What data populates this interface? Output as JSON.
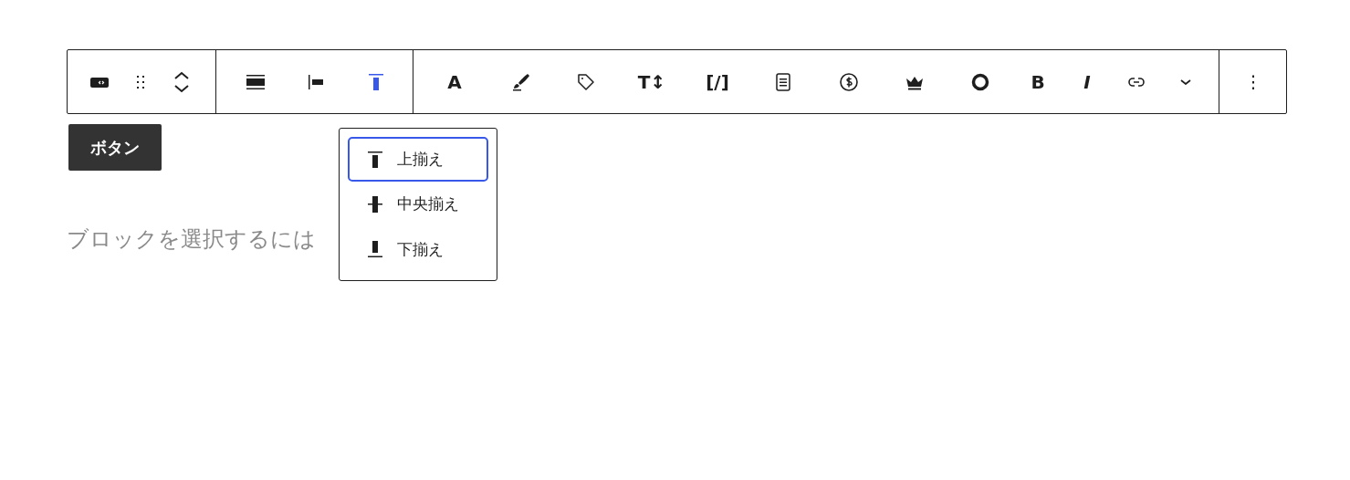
{
  "toolbar": {
    "groups": [
      [
        {
          "kind": "block"
        },
        {
          "kind": "drag"
        },
        {
          "kind": "mover"
        }
      ],
      [
        {
          "kind": "align-wide",
          "selected": false
        },
        {
          "kind": "align-left",
          "selected": false
        },
        {
          "kind": "valign-top",
          "selected": true
        }
      ],
      [
        {
          "kind": "glyph",
          "label": "A"
        },
        {
          "kind": "brush"
        },
        {
          "kind": "tag"
        },
        {
          "kind": "glyph",
          "label": "T↕"
        },
        {
          "kind": "glyph",
          "label": "[/]"
        },
        {
          "kind": "document"
        },
        {
          "kind": "dollar"
        },
        {
          "kind": "crown"
        },
        {
          "kind": "circle"
        },
        {
          "kind": "glyph",
          "label": "B"
        },
        {
          "kind": "glyph-italic",
          "label": "I"
        },
        {
          "kind": "link"
        },
        {
          "kind": "chevron"
        }
      ],
      [
        {
          "kind": "more"
        }
      ]
    ]
  },
  "button": {
    "label": "ボタン"
  },
  "placeholder": "ブロックを選択するには",
  "popover": {
    "items": [
      {
        "kind": "valign-top",
        "label": "上揃え",
        "selected": true
      },
      {
        "kind": "valign-center",
        "label": "中央揃え",
        "selected": false
      },
      {
        "kind": "valign-bottom",
        "label": "下揃え",
        "selected": false
      }
    ]
  }
}
